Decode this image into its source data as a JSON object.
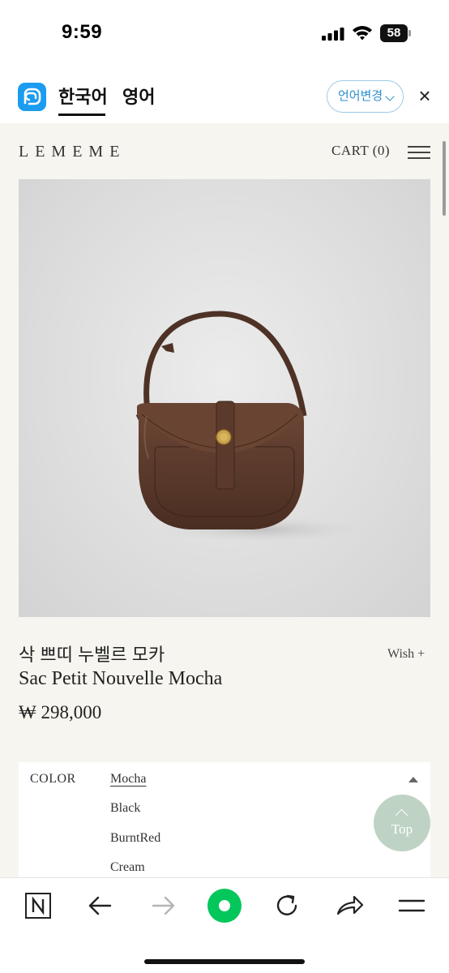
{
  "status_bar": {
    "time": "9:59",
    "battery": "58"
  },
  "translate_bar": {
    "tabs": [
      {
        "label": "한국어",
        "active": true
      },
      {
        "label": "영어",
        "active": false
      }
    ],
    "change_language_label": "언어변경",
    "close_symbol": "×",
    "colors": {
      "accent": "#1b9cf0",
      "button_text": "#2f8fd0"
    }
  },
  "header": {
    "logo": "LEMEME",
    "cart_label": "CART (0)",
    "menu_icon": "hamburger-icon"
  },
  "product": {
    "image_alt": "brown leather half-moon shoulder bag",
    "name_ko": "삭 쁘띠 누벨르 모카",
    "name_en": "Sac Petit Nouvelle Mocha",
    "price": "₩ 298,000",
    "wish_label": "Wish +"
  },
  "options": {
    "label": "COLOR",
    "items": [
      "Mocha",
      "Black",
      "BurntRed",
      "Cream"
    ],
    "selected": "Mocha"
  },
  "top_button": {
    "label": "Top"
  },
  "toolbar": {
    "items": [
      "naver-home-icon",
      "back-arrow-icon",
      "forward-arrow-icon",
      "green-dot-icon",
      "reload-icon",
      "share-icon",
      "menu-icon"
    ],
    "colors": {
      "green": "#03c75a"
    }
  },
  "colors": {
    "page_bg": "#f6f5f0",
    "bag": "#5a3a2b",
    "top_button": "#aac4b0"
  }
}
